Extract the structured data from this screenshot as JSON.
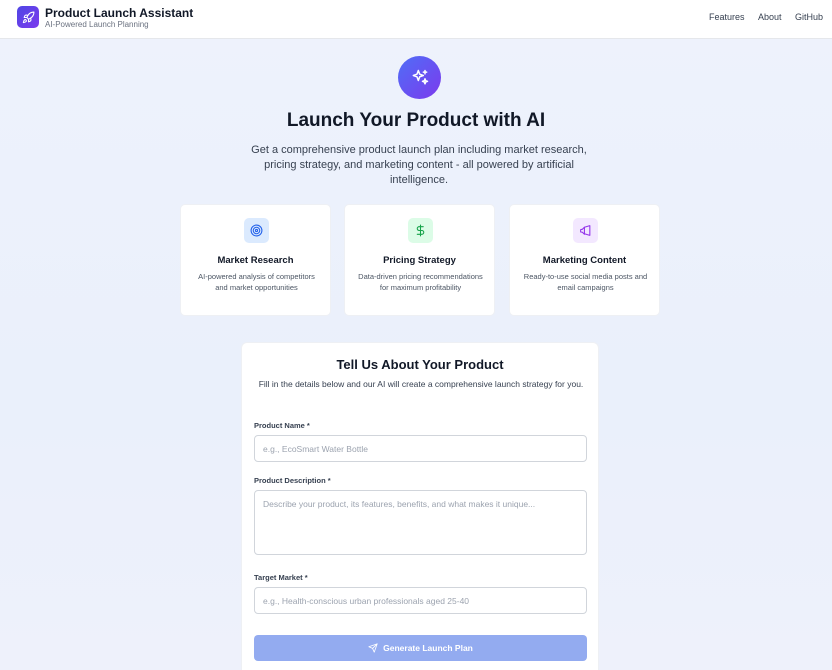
{
  "header": {
    "app_title": "Product Launch Assistant",
    "app_subtitle": "AI-Powered Launch Planning",
    "logo_icon": "rocket-icon",
    "nav": [
      "Features",
      "About",
      "GitHub"
    ]
  },
  "hero": {
    "icon": "sparkles-icon",
    "title": "Launch Your Product with AI",
    "description": "Get a comprehensive product launch plan including market research, pricing strategy, and marketing content - all powered by artificial intelligence."
  },
  "features": [
    {
      "icon": "target-icon",
      "title": "Market Research",
      "description": "AI-powered analysis of competitors and market opportunities",
      "color": "#2563eb"
    },
    {
      "icon": "dollar-icon",
      "title": "Pricing Strategy",
      "description": "Data-driven pricing recommendations for maximum profitability",
      "color": "#16a34a"
    },
    {
      "icon": "megaphone-icon",
      "title": "Marketing Content",
      "description": "Ready-to-use social media posts and email campaigns",
      "color": "#9333ea"
    }
  ],
  "form": {
    "title": "Tell Us About Your Product",
    "description": "Fill in the details below and our AI will create a comprehensive launch strategy for you.",
    "product_name": {
      "label": "Product Name *",
      "placeholder": "e.g., EcoSmart Water Bottle",
      "value": ""
    },
    "product_description": {
      "label": "Product Description *",
      "placeholder": "Describe your product, its features, benefits, and what makes it unique...",
      "value": ""
    },
    "target_market": {
      "label": "Target Market *",
      "placeholder": "e.g., Health-conscious urban professionals aged 25-40",
      "value": ""
    },
    "submit_label": "Generate Launch Plan",
    "submit_icon": "send-icon"
  },
  "colors": {
    "brand_gradient_start": "#4f46e5",
    "brand_gradient_end": "#7c3aed",
    "button_disabled": "#93abf0"
  }
}
